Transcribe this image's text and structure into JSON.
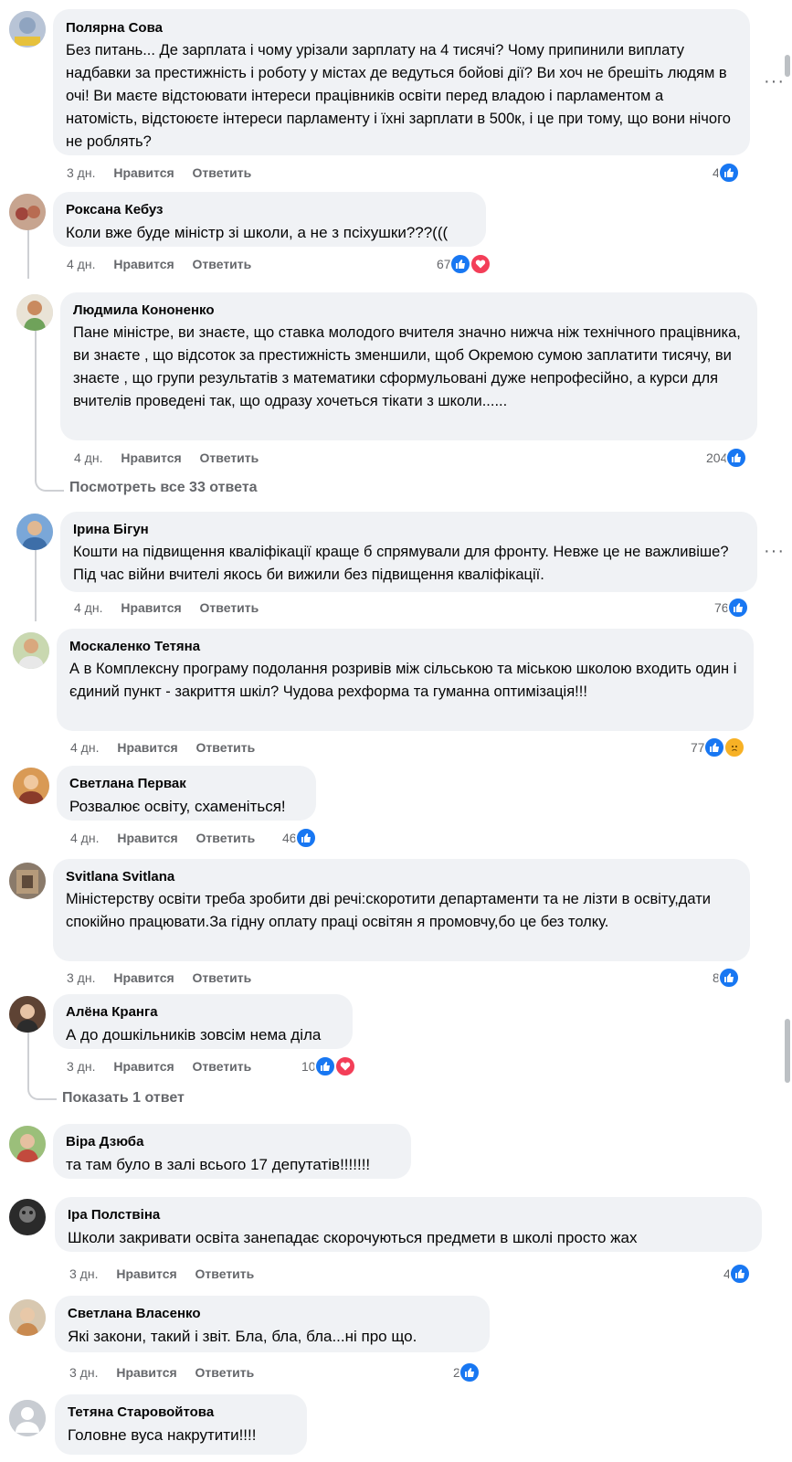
{
  "comments": [
    {
      "author": "Полярна Сова",
      "text": "Без питань... Де зарплата і чому урізали зарплату на 4 тисячі? Чому припинили виплату надбавки за престижність і роботу у містах де ведуться бойові дії? Ви хоч не брешіть людям в очі! Ви маєте відстоювати інтереси працівників освіти перед владою і парламентом а натомість, відстоюєте інтереси парламенту і їхні зарплати в 500к, і це при тому, що вони нічого не роблять?",
      "time": "3 дн.",
      "like": "Нравится",
      "reply": "Ответить",
      "count": "4"
    },
    {
      "author": "Роксана Кебуз",
      "text": "Коли вже буде міністр зі школи, а не з псіхушки???(((",
      "time": "4 дн.",
      "like": "Нравится",
      "reply": "Ответить",
      "count": "67"
    },
    {
      "author": "Людмила Кононенко",
      "text": "Пане міністре, ви знаєте, що ставка молодого вчителя значно нижча ніж технічного працівника, ви знаєте , що відсоток за престижність зменшили, щоб Окремою сумою заплатити тисячу, ви знаєте , що групи результатів з математики сформульовані дуже непрофесійно, а курси для вчителів проведені так, що одразу хочеться тікати з школи......",
      "time": "4 дн.",
      "like": "Нравится",
      "reply": "Ответить",
      "count": "204"
    },
    {
      "author": "Ірина Бігун",
      "text": "Кошти на підвищення кваліфікації краще б спрямували для фронту. Невже це не важливіше? Під час війни вчителі якось би вижили без підвищення кваліфікації.",
      "time": "4 дн.",
      "like": "Нравится",
      "reply": "Ответить",
      "count": "76"
    },
    {
      "author": "Москаленко Тетяна",
      "text": "А в Комплексну програму подолання розривів між сільською та міською школою входить один і єдиний пункт - закриття шкіл? Чудова рехформа та гуманна оптимізація!!!",
      "time": "4 дн.",
      "like": "Нравится",
      "reply": "Ответить",
      "count": "77"
    },
    {
      "author": "Светлана Первак",
      "text": "Розвалює освіту, схаменіться!",
      "time": "4 дн.",
      "like": "Нравится",
      "reply": "Ответить",
      "count": "46"
    },
    {
      "author": "Svitlana Svitlana",
      "text": "Міністерству освіти треба зробити дві речі:скоротити департаменти та не лізти в освіту,дати спокійно працювати.За гідну оплату праці освітян я промовчу,бо це без толку.",
      "time": "3 дн.",
      "like": "Нравится",
      "reply": "Ответить",
      "count": "8"
    },
    {
      "author": "Алёна Кранга",
      "text": "А до дошкільників зовсім нема діла",
      "time": "3 дн.",
      "like": "Нравится",
      "reply": "Ответить",
      "count": "10"
    },
    {
      "author": "Віра Дзюба",
      "text": "та там було в залі всього 17 депутатів!!!!!!!"
    },
    {
      "author": "Іра Полствіна",
      "text": "Школи закривати освіта занепадає скорочуються предмети в школі просто жах",
      "time": "3 дн.",
      "like": "Нравится",
      "reply": "Ответить",
      "count": "4"
    },
    {
      "author": "Светлана Власенко",
      "text": "Які закони, такий і звіт. Бла, бла, бла...ні про що.",
      "time": "3 дн.",
      "like": "Нравится",
      "reply": "Ответить",
      "count": "2"
    },
    {
      "author": "Тетяна Старовойтова",
      "text": "Головне вуса накрутити!!!!"
    }
  ],
  "more_replies": {
    "view_all": "Посмотреть все 33 ответа",
    "show_one": "Показать 1 ответ"
  },
  "options_dots": "···",
  "colors": {
    "bubble": "#f0f2f5",
    "like": "#1877f2",
    "love": "#f33e58",
    "sad": "#f7b125",
    "meta": "#65676b"
  },
  "icons": {
    "like": "thumbs-up-icon",
    "love": "heart-icon",
    "sad": "sad-face-icon",
    "options": "more-options-icon"
  }
}
